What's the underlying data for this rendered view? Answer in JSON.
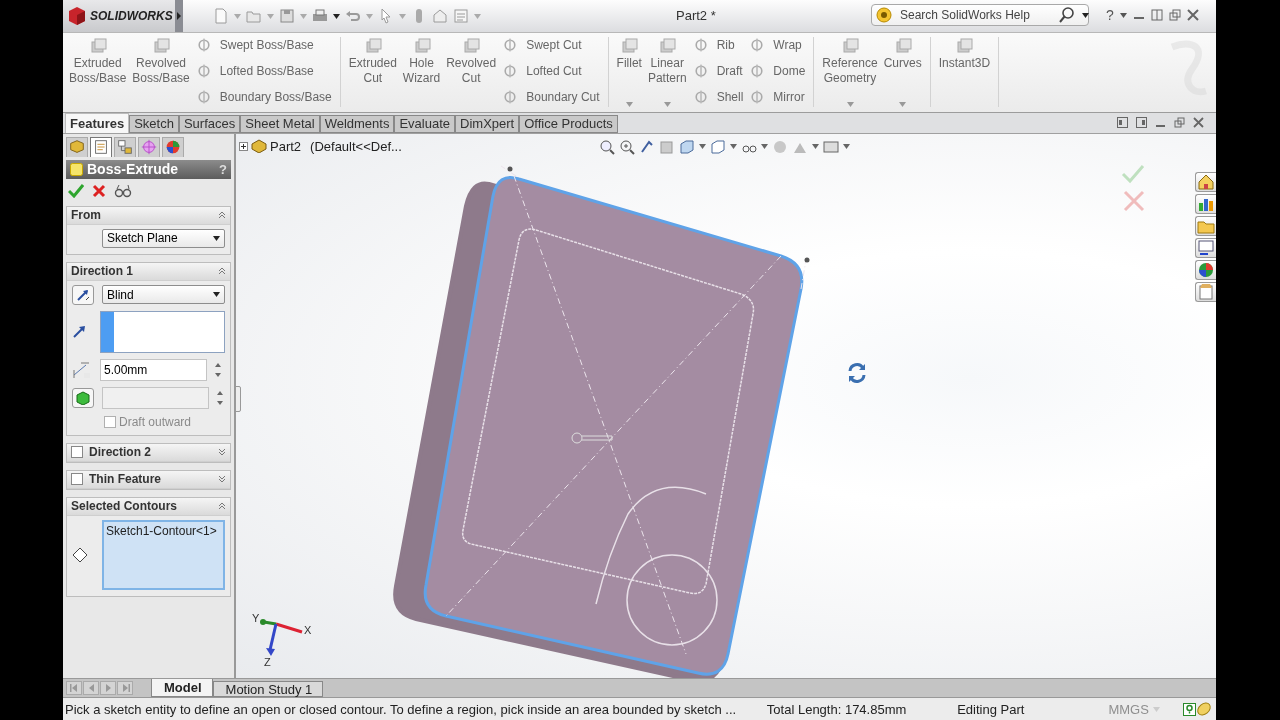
{
  "app": {
    "logo": "SOLIDWORKS",
    "title": "Part2 *",
    "search": {
      "placeholder": "Search SolidWorks Help"
    },
    "help": "?"
  },
  "ribbon": {
    "groups": [
      {
        "columns": [
          {
            "kind": "large",
            "label": "Extruded Boss/Base",
            "menu": false
          },
          {
            "kind": "large",
            "label": "Revolved Boss/Base",
            "menu": false
          },
          {
            "kind": "stack",
            "items": [
              "Swept Boss/Base",
              "Lofted Boss/Base",
              "Boundary Boss/Base"
            ]
          }
        ]
      },
      {
        "columns": [
          {
            "kind": "large",
            "label": "Extruded Cut",
            "menu": false
          },
          {
            "kind": "large",
            "label": "Hole Wizard",
            "menu": false
          },
          {
            "kind": "large",
            "label": "Revolved Cut",
            "menu": false
          },
          {
            "kind": "stack",
            "items": [
              "Swept Cut",
              "Lofted Cut",
              "Boundary Cut"
            ]
          }
        ]
      },
      {
        "columns": [
          {
            "kind": "large",
            "label": "Fillet",
            "menu": true
          },
          {
            "kind": "large",
            "label": "Linear Pattern",
            "menu": true
          },
          {
            "kind": "stack",
            "items": [
              "Rib",
              "Draft",
              "Shell"
            ]
          },
          {
            "kind": "stack",
            "items": [
              "Wrap",
              "Dome",
              "Mirror"
            ]
          }
        ]
      },
      {
        "columns": [
          {
            "kind": "large",
            "label": "Reference Geometry",
            "menu": true
          },
          {
            "kind": "large",
            "label": "Curves",
            "menu": true
          }
        ]
      },
      {
        "columns": [
          {
            "kind": "large",
            "label": "Instant3D",
            "menu": false
          }
        ]
      }
    ]
  },
  "tabs": [
    {
      "label": "Features",
      "selected": true
    },
    {
      "label": "Sketch",
      "selected": false
    },
    {
      "label": "Surfaces",
      "selected": false
    },
    {
      "label": "Sheet Metal",
      "selected": false
    },
    {
      "label": "Weldments",
      "selected": false
    },
    {
      "label": "Evaluate",
      "selected": false
    },
    {
      "label": "DimXpert",
      "selected": false
    },
    {
      "label": "Office Products",
      "selected": false
    }
  ],
  "property_manager": {
    "tabs": [
      {
        "selected": false
      },
      {
        "selected": true
      },
      {
        "selected": false
      },
      {
        "selected": false
      },
      {
        "selected": false
      }
    ],
    "title": "Boss-Extrude",
    "help": "?",
    "sections": [
      {
        "kind": "from",
        "title": "From",
        "expanded": true,
        "select": "Sketch Plane"
      },
      {
        "kind": "direction",
        "title": "Direction 1",
        "expanded": true,
        "select": "Blind",
        "depth": "5.00mm",
        "draft_outward": {
          "label": "Draft outward",
          "checked": false
        }
      },
      {
        "kind": "optional",
        "title": "Direction 2",
        "checked": false,
        "expanded": false
      },
      {
        "kind": "optional",
        "title": "Thin Feature",
        "checked": false,
        "expanded": false
      },
      {
        "kind": "list",
        "title": "Selected Contours",
        "expanded": true,
        "items": [
          "Sketch1-Contour<1>"
        ]
      }
    ]
  },
  "viewport": {
    "tree": {
      "name": "Part2",
      "config": "(Default<<Def..."
    },
    "triad": [
      "Y",
      "X",
      "Z"
    ]
  },
  "bottom_tabs": [
    {
      "label": "Model",
      "selected": true
    },
    {
      "label": "Motion Study 1",
      "selected": false
    }
  ],
  "status_bar": {
    "message": "Pick a sketch entity to define an open or closed contour. To define a region, pick inside an area bounded by sketch ...",
    "length": "Total Length: 174.85mm",
    "mode": "Editing Part",
    "units": "MMGS"
  }
}
